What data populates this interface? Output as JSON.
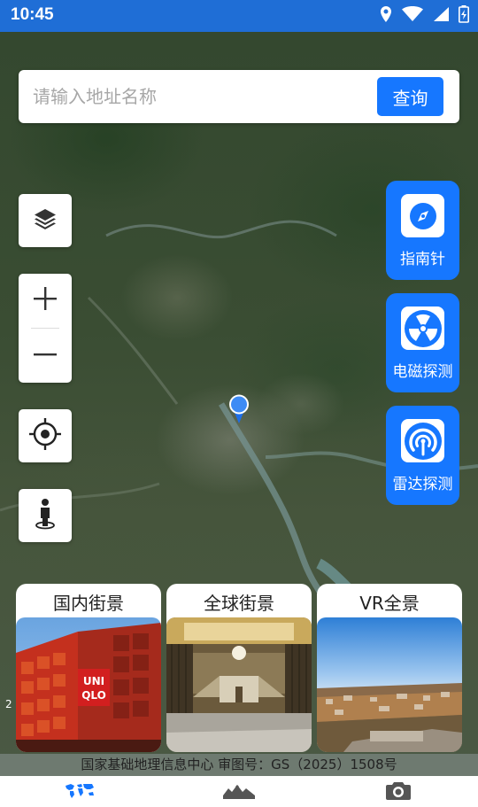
{
  "status_bar": {
    "time": "10:45",
    "icons": [
      "location-icon",
      "wifi-icon",
      "signal-icon",
      "battery-icon"
    ]
  },
  "search": {
    "placeholder": "请输入地址名称",
    "value": "",
    "button_label": "查询"
  },
  "left_tools": [
    {
      "name": "layers-icon"
    },
    {
      "name": "zoom-in-icon",
      "label": "+"
    },
    {
      "name": "zoom-out-icon",
      "label": "−"
    },
    {
      "name": "locate-icon"
    },
    {
      "name": "street-view-person-icon"
    }
  ],
  "features": [
    {
      "label": "指南针",
      "icon": "compass-icon"
    },
    {
      "label": "电磁探测",
      "icon": "radiation-icon"
    },
    {
      "label": "雷达探测",
      "icon": "radar-icon"
    }
  ],
  "cards": [
    {
      "title": "国内街景"
    },
    {
      "title": "全球街景"
    },
    {
      "title": "VR全景"
    }
  ],
  "scale_mark": "2",
  "attribution": "国家基础地理信息中心  审图号：GS（2025）1508号",
  "bottom_nav": [
    {
      "icon": "world-map-icon",
      "active": true
    },
    {
      "icon": "landscape-icon",
      "active": false
    },
    {
      "icon": "camera-icon",
      "active": false
    }
  ],
  "colors": {
    "accent": "#1677ff",
    "status_bar": "#1f6ed6"
  }
}
